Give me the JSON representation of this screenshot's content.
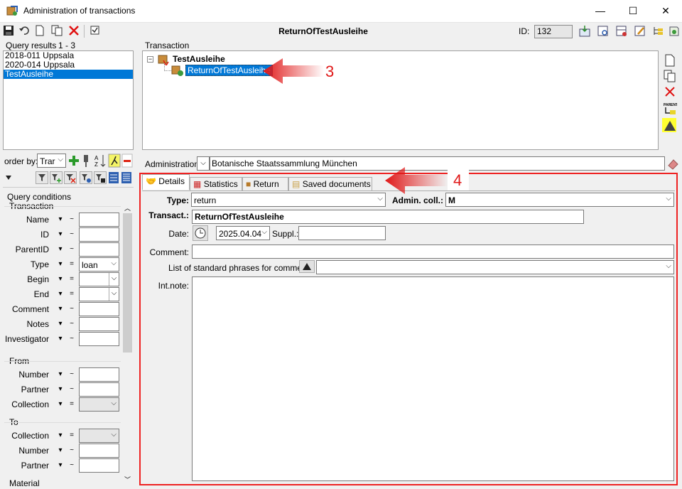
{
  "window": {
    "title": "Administration of transactions",
    "minimize": "—",
    "maximize": "☐",
    "close": "✕"
  },
  "toolbar": {
    "current_record": "ReturnOfTestAusleihe",
    "id_label": "ID:",
    "id_value": "132"
  },
  "query_results": {
    "label": "Query results",
    "range": "1 - 3",
    "items": [
      "2018-011 Uppsala",
      "2020-014 Uppsala",
      "TestAusleihe"
    ],
    "selected_index": 2
  },
  "order_by": {
    "label": "order by:",
    "value": "Trar"
  },
  "query_conditions": {
    "label": "Query conditions",
    "transaction_group": "Transaction",
    "rows": [
      {
        "label": "Name",
        "op": "~",
        "kind": "text",
        "value": ""
      },
      {
        "label": "ID",
        "op": "~",
        "kind": "text",
        "value": ""
      },
      {
        "label": "ParentID",
        "op": "~",
        "kind": "text",
        "value": ""
      },
      {
        "label": "Type",
        "op": "=",
        "kind": "combo",
        "value": "loan"
      },
      {
        "label": "Begin",
        "op": "=",
        "kind": "date",
        "value": ""
      },
      {
        "label": "End",
        "op": "=",
        "kind": "date",
        "value": ""
      },
      {
        "label": "Comment",
        "op": "~",
        "kind": "text",
        "value": ""
      },
      {
        "label": "Notes",
        "op": "~",
        "kind": "text",
        "value": ""
      },
      {
        "label": "Investigator",
        "op": "~",
        "kind": "text",
        "value": ""
      }
    ],
    "from_group": "From",
    "from_rows": [
      {
        "label": "Number",
        "op": "~",
        "kind": "text",
        "value": ""
      },
      {
        "label": "Partner",
        "op": "~",
        "kind": "text",
        "value": ""
      },
      {
        "label": "Collection",
        "op": "=",
        "kind": "combo",
        "value": ""
      }
    ],
    "to_group": "To",
    "to_rows": [
      {
        "label": "Collection",
        "op": "=",
        "kind": "combo",
        "value": ""
      },
      {
        "label": "Number",
        "op": "~",
        "kind": "text",
        "value": ""
      },
      {
        "label": "Partner",
        "op": "~",
        "kind": "text",
        "value": ""
      }
    ],
    "material_group": "Material"
  },
  "transaction_tree": {
    "label": "Transaction",
    "root": "TestAusleihe",
    "child": "ReturnOfTestAusleihe"
  },
  "administration": {
    "label": "Administration:",
    "value": "Botanische Staatssammlung München"
  },
  "tabs": [
    "Details",
    "Statistics",
    "Return",
    "Saved documents"
  ],
  "details": {
    "type_label": "Type:",
    "type_value": "return",
    "admin_coll_label": "Admin. coll.:",
    "admin_coll_value": "M",
    "transact_label": "Transact.:",
    "transact_value": "ReturnOfTestAusleihe",
    "date_label": "Date:",
    "date_value": "2025.04.04",
    "suppl_label": "Suppl.:",
    "suppl_value": "",
    "comment_label": "Comment:",
    "comment_value": "",
    "phrases_label": "List of standard phrases for comment:",
    "intnote_label": "Int.note:",
    "intnote_value": ""
  },
  "annotations": {
    "arrow3": "3",
    "arrow4": "4"
  },
  "colors": {
    "selection": "#0078d7",
    "annotation": "#e01818"
  }
}
